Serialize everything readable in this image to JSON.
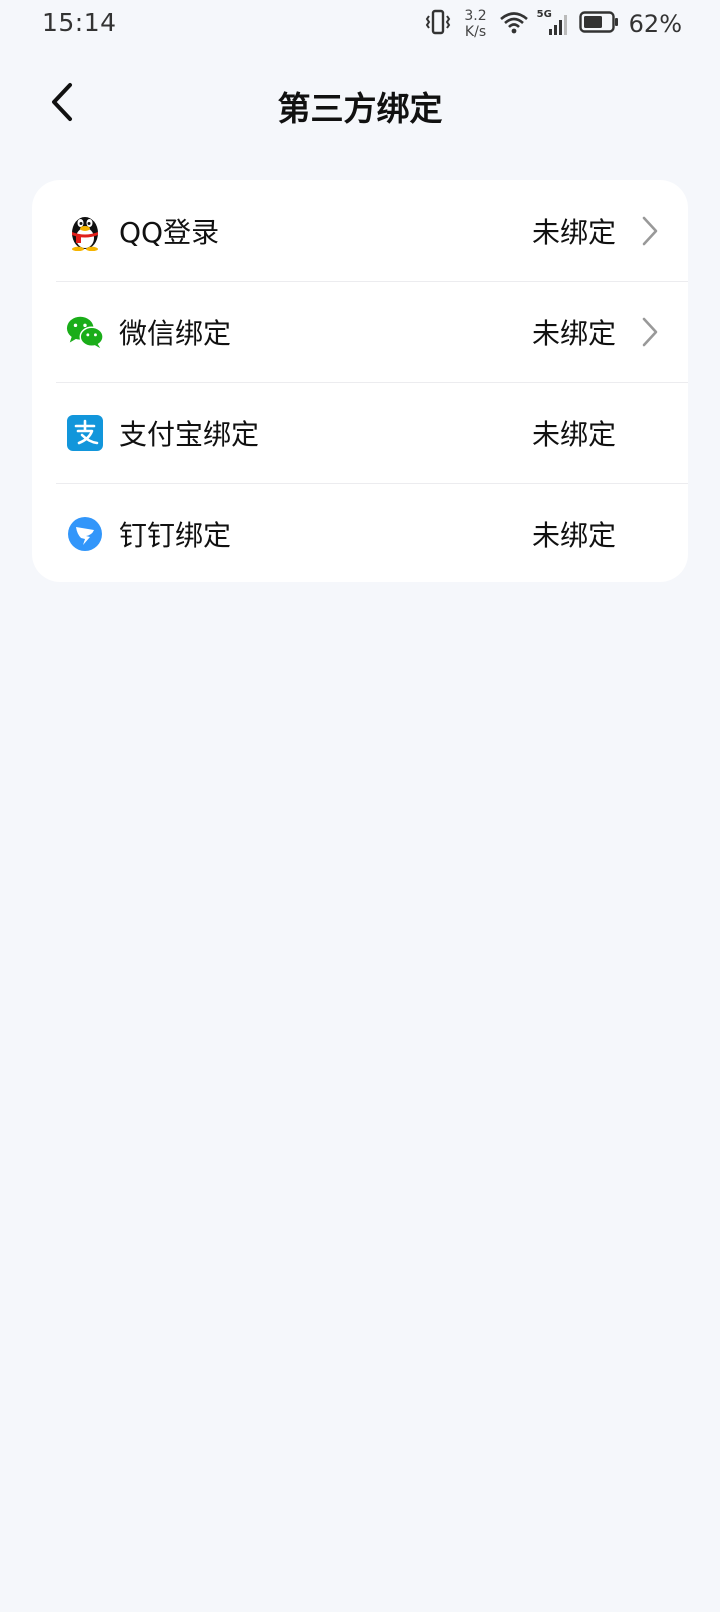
{
  "status_bar": {
    "time": "15:14",
    "net_speed_value": "3.2",
    "net_speed_unit": "K/s",
    "network_type": "5G",
    "battery_percent": "62%",
    "icons": [
      "vibrate-icon",
      "wifi-icon",
      "signal-icon",
      "battery-icon"
    ]
  },
  "header": {
    "title": "第三方绑定",
    "back_icon": "chevron-left-icon"
  },
  "bindings": [
    {
      "label": "QQ登录",
      "status": "未绑定",
      "icon": "qq-penguin-icon",
      "has_chevron": true
    },
    {
      "label": "微信绑定",
      "status": "未绑定",
      "icon": "wechat-icon",
      "has_chevron": true
    },
    {
      "label": "支付宝绑定",
      "status": "未绑定",
      "icon": "alipay-icon",
      "has_chevron": false
    },
    {
      "label": "钉钉绑定",
      "status": "未绑定",
      "icon": "dingtalk-icon",
      "has_chevron": false
    }
  ],
  "colors": {
    "background": "#f5f7fb",
    "card": "#ffffff",
    "wechat_green": "#1aad19",
    "alipay_blue": "#1296db",
    "dingtalk_blue": "#3296fa",
    "chevron_gray": "#999999"
  }
}
